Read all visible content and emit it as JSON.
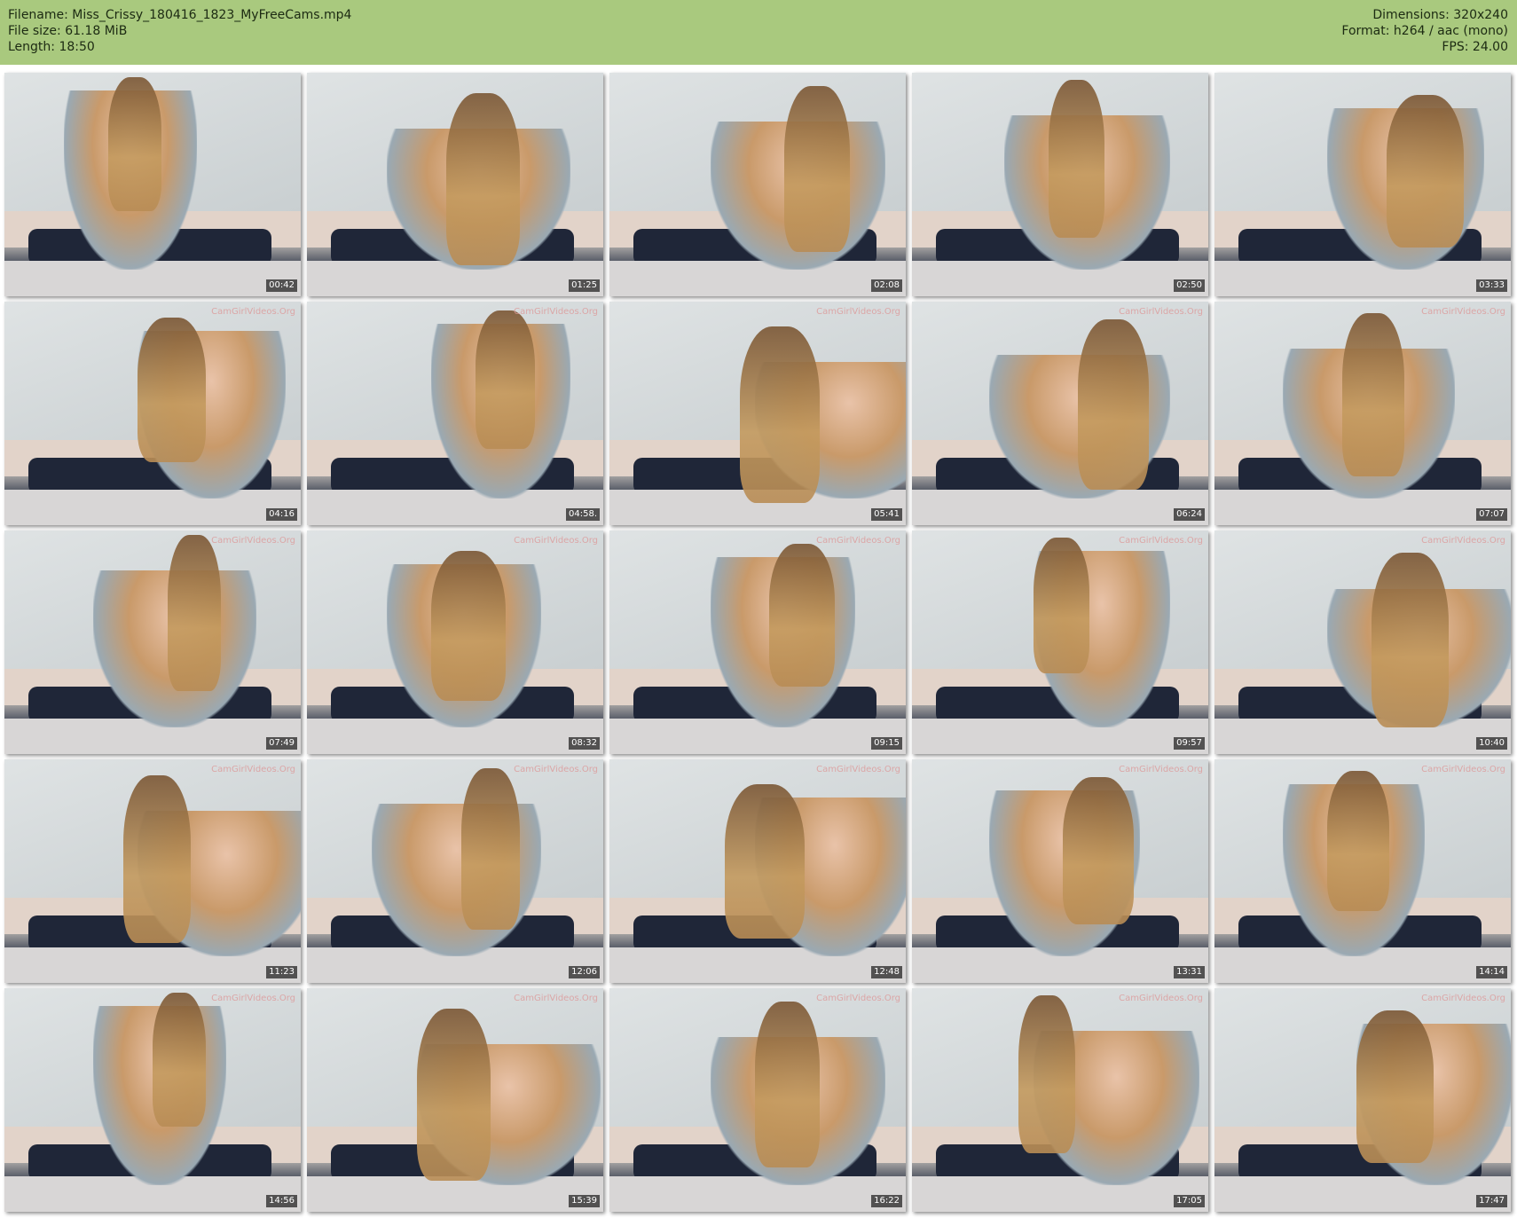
{
  "header": {
    "filename": "Filename: Miss_Crissy_180416_1823_MyFreeCams.mp4",
    "filesize": "File size: 61.18 MiB",
    "length": "Length: 18:50",
    "dimensions": "Dimensions: 320x240",
    "format": "Format: h264 / aac (mono)",
    "fps": "FPS: 24.00"
  },
  "watermark": "CamGirlVideos.Org",
  "thumbnails": [
    "00:42",
    "01:25",
    "02:08",
    "02:50",
    "03:33",
    "04:16",
    "04:58.",
    "05:41",
    "06:24",
    "07:07",
    "07:49",
    "08:32",
    "09:15",
    "09:57",
    "10:40",
    "11:23",
    "12:06",
    "12:48",
    "13:31",
    "14:14",
    "14:56",
    "15:39",
    "16:22",
    "17:05",
    "17:47"
  ],
  "colors": {
    "header_bg": "#a9c97e",
    "page_bg": "#ffffff"
  }
}
